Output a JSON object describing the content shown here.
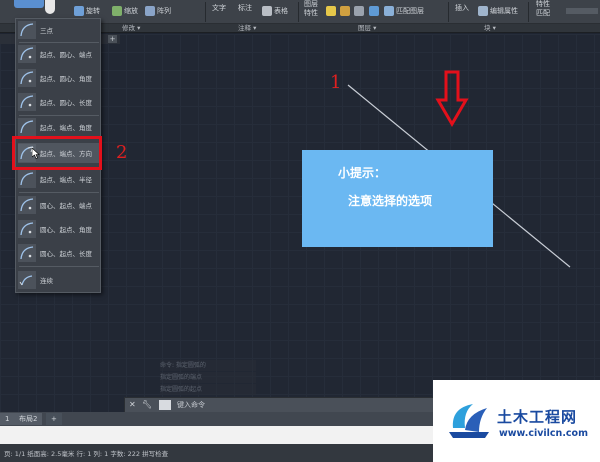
{
  "ribbon": {
    "rotate_label": "旋转",
    "scale_label": "缩放",
    "array_label": "阵列",
    "text_label": "文字",
    "dim_label": "标注",
    "table_label": "表格",
    "layer_props_label": "图层\n特性",
    "match_layer_label": "匹配图层",
    "insert_label": "插入",
    "edit_attr_label": "编辑属性",
    "props_label": "特性\n匹配",
    "panels": [
      "修改",
      "注释",
      "图层",
      "块"
    ]
  },
  "arc_menu": {
    "items": [
      {
        "label": "三点"
      },
      {
        "label": "起点、圆心、端点"
      },
      {
        "label": "起点、圆心、角度"
      },
      {
        "label": "起点、圆心、长度"
      },
      {
        "label": "起点、端点、角度"
      },
      {
        "label": "起点、端点、方向"
      },
      {
        "label": "起点、端点、半径"
      },
      {
        "label": "圆心、起点、端点"
      },
      {
        "label": "圆心、起点、角度"
      },
      {
        "label": "圆心、起点、长度"
      },
      {
        "label": "连续"
      }
    ]
  },
  "annotations": {
    "num1": "1",
    "num2": "2"
  },
  "tip": {
    "title": "小提示：",
    "body": "注意选择的选项"
  },
  "cmd": {
    "history": [
      "命令: 指定圆弧的",
      "指定圆弧的端点",
      "指定圆弧的起点"
    ],
    "prompt": "键入命令"
  },
  "tabs": {
    "layout1": "1",
    "layout2": "布局2",
    "add": "+"
  },
  "status": {
    "text": "页: 1/1  纸面高: 2.5毫米  行: 1  列: 1  字数: 222  拼写检查"
  },
  "watermark": {
    "name": "土木工程网",
    "url": "www.civilcn.com"
  },
  "colors": {
    "accent_red": "#e3101b",
    "tip_blue": "#6bb8f2",
    "wm_blue": "#1a4aa0"
  }
}
